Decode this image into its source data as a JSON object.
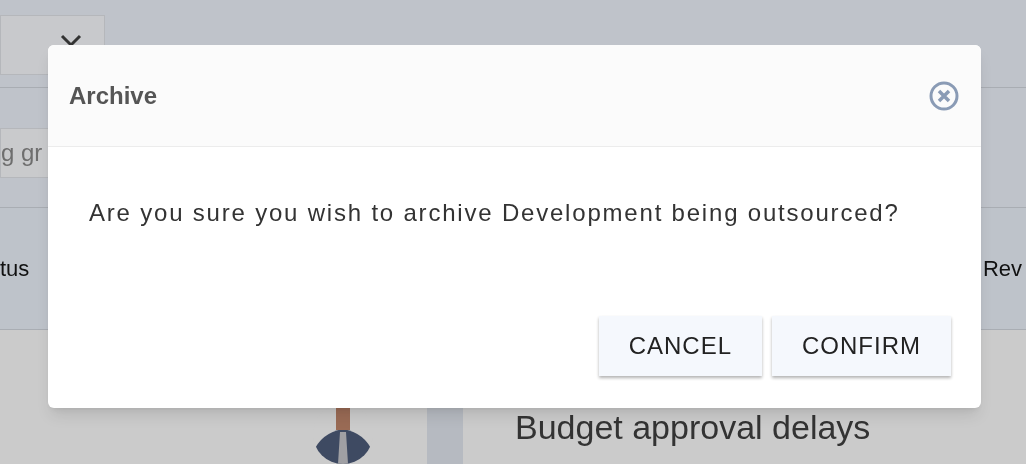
{
  "background": {
    "search": {
      "placeholder": "g gr"
    },
    "columns": [
      "tus",
      "Rev"
    ],
    "card_title": "Budget approval delays"
  },
  "dialog": {
    "title": "Archive",
    "message": "Are you sure you wish to archive Development being outsourced?",
    "buttons": [
      "CANCEL",
      "CONFIRM"
    ]
  }
}
